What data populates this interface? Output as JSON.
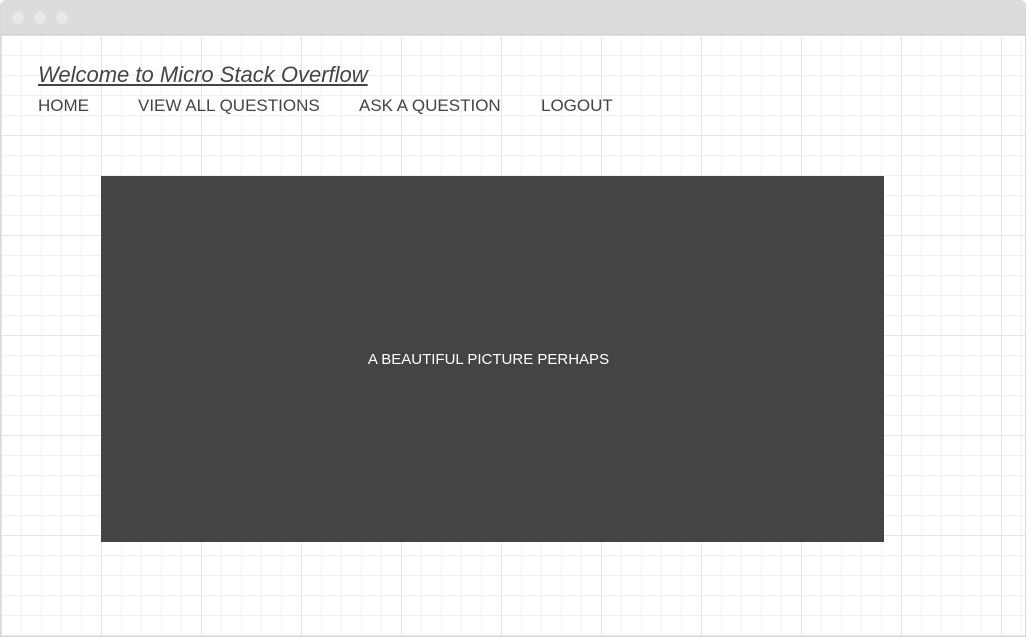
{
  "header": {
    "title": "Welcome to Micro Stack Overflow"
  },
  "nav": {
    "home": "HOME",
    "view_all_questions": "VIEW ALL QUESTIONS",
    "ask_a_question": "ASK A QUESTION",
    "logout": "LOGOUT"
  },
  "hero": {
    "placeholder_text": "A BEAUTIFUL PICTURE PERHAPS"
  },
  "colors": {
    "hero_background": "#444444",
    "text": "#444444",
    "titlebar": "#dcdcdc"
  }
}
